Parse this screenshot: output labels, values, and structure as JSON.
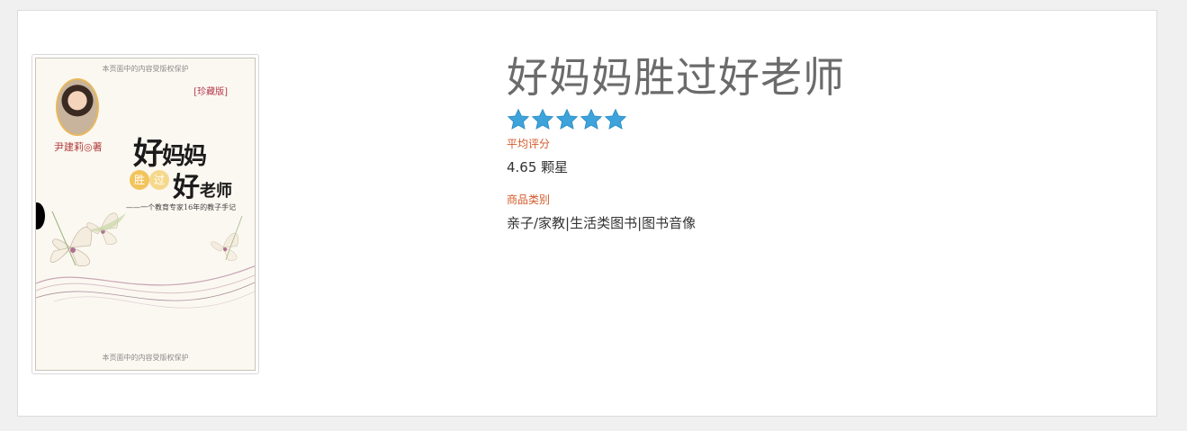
{
  "product": {
    "title": "好妈妈胜过好老师",
    "rating_stars": 5,
    "rating_label": "平均评分",
    "rating_value": "4.65 颗星",
    "category_label": "商品类别",
    "category_value": "亲子/家教|生活类图书|图书音像"
  },
  "cover": {
    "notice_top": "本页面中的内容受版权保护",
    "notice_bottom": "本页面中的内容受版权保护",
    "edition": "[珍藏版]",
    "author": "尹建莉◎著",
    "title_line1_big": "好",
    "title_line1_small": "妈妈",
    "title_sheng": "胜",
    "title_guo": "过",
    "title_line2_big": "好",
    "title_line2_small": "老师",
    "subtitle": "——一个教育专家16年的教子手记"
  },
  "colors": {
    "star": "#3ea3da",
    "label": "#d35a2a",
    "title": "#6b6b6b"
  }
}
